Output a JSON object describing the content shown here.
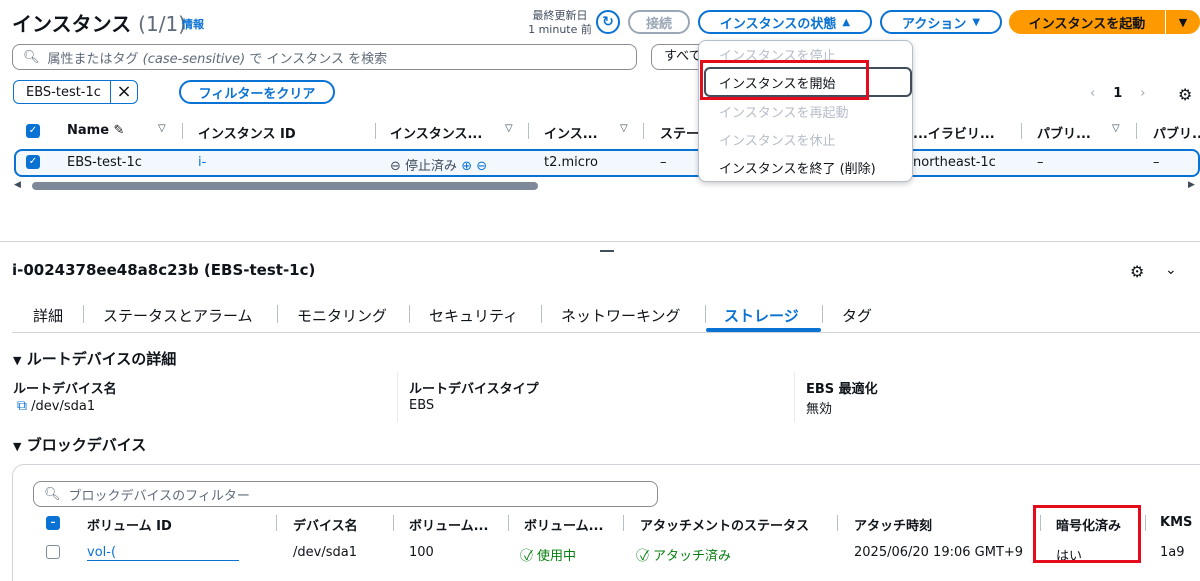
{
  "header": {
    "title": "インスタンス",
    "count": "(1/1)",
    "info_link": "情報",
    "last_updated_label": "最終更新日",
    "last_updated_value": "1 minute 前",
    "connect_label": "接続",
    "state_label": "インスタンスの状態",
    "action_label": "アクション",
    "launch_label": "インスタンスを起動"
  },
  "search": {
    "prefix": "属性またはタグ",
    "italic": "(case-sensitive)",
    "suffix": "で インスタンス を検索",
    "select_value": "すべて"
  },
  "filter": {
    "chip_label": "EBS-test-1c",
    "clear_label": "フィルターをクリア"
  },
  "pagination": {
    "current_page": "1"
  },
  "instance_table": {
    "headers": [
      "Name",
      "インスタンス ID",
      "インスタンス...",
      "インス...",
      "ステー",
      "...イラビリ...",
      "パブリ...",
      "パブリ..."
    ],
    "row": {
      "name": "EBS-test-1c",
      "instance_id": "i-",
      "state": "停止済み",
      "type": "t2.micro",
      "status_check": "–",
      "az": "northeast-1c",
      "public_dns": "–",
      "public_ip": "–"
    }
  },
  "state_menu": {
    "items": [
      "インスタンスを停止",
      "インスタンスを開始",
      "インスタンスを再起動",
      "インスタンスを休止",
      "インスタンスを終了 (削除)"
    ]
  },
  "detail": {
    "title": "i-0024378ee48a8c23b (EBS-test-1c)",
    "tabs": [
      "詳細",
      "ステータスとアラーム",
      "モニタリング",
      "セキュリティ",
      "ネットワーキング",
      "ストレージ",
      "タグ"
    ],
    "root_section": "ルートデバイスの詳細",
    "root_device_name_label": "ルートデバイス名",
    "root_device_name": "/dev/sda1",
    "root_device_type_label": "ルートデバイスタイプ",
    "root_device_type": "EBS",
    "ebs_optimized_label": "EBS 最適化",
    "ebs_optimized": "無効",
    "block_section": "ブロックデバイス",
    "block_filter_placeholder": "ブロックデバイスのフィルター"
  },
  "block_table": {
    "headers": [
      "ボリューム ID",
      "デバイス名",
      "ボリューム...",
      "ボリューム...",
      "アタッチメントのステータス",
      "アタッチ時刻",
      "暗号化済み",
      "KMS"
    ],
    "row": {
      "volume_id": "vol-(",
      "device": "/dev/sda1",
      "size": "100",
      "volume_state": "使用中",
      "attachment_status": "アタッチ済み",
      "attach_time": "2025/06/20 19:06 GMT+9",
      "encrypted": "はい",
      "kms": "1a9"
    }
  },
  "colors": {
    "accent": "#0972d3",
    "primary": "#ff9900",
    "highlight": "#e30b1c"
  }
}
